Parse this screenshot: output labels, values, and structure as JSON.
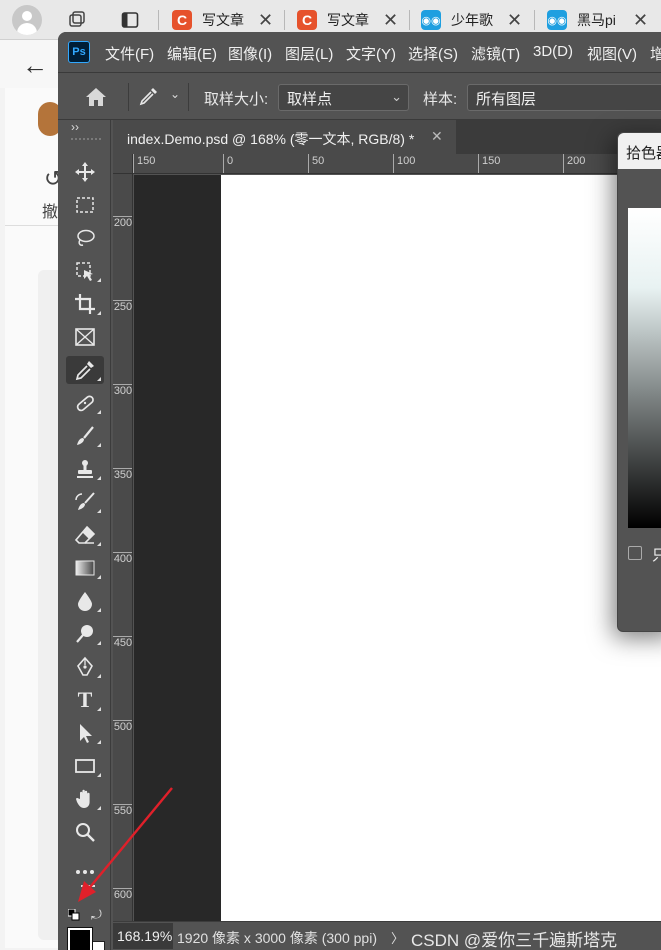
{
  "browser": {
    "tabs": [
      {
        "icon": "csdn-icon",
        "title": "写文章",
        "color": "#e6522c"
      },
      {
        "icon": "csdn-icon",
        "title": "写文章",
        "color": "#e6522c"
      },
      {
        "icon": "bilibili-icon",
        "title": "少年歌",
        "color": "#1e9fe0"
      },
      {
        "icon": "bilibili-icon",
        "title": "黑马pi",
        "color": "#1e9fe0"
      }
    ],
    "bg_undo_label": "撤"
  },
  "ps": {
    "logo": "Ps",
    "menu": [
      "文件(F)",
      "编辑(E)",
      "图像(I)",
      "图层(L)",
      "文字(Y)",
      "选择(S)",
      "滤镜(T)",
      "3D(D)",
      "视图(V)",
      "增"
    ],
    "options": {
      "sample_size_label": "取样大小:",
      "sample_size_value": "取样点",
      "sample_label": "样本:",
      "sample_value": "所有图层"
    },
    "document_tab": "index.Demo.psd @ 168% (零一文本, RGB/8) *",
    "ruler_h": [
      "150",
      "0",
      "50",
      "100",
      "150",
      "200"
    ],
    "ruler_v": [
      "200",
      "250",
      "300",
      "350",
      "400",
      "450",
      "500",
      "550",
      "600"
    ],
    "status": {
      "zoom": "168.19%",
      "doc_info": "1920 像素 x 3000 像素 (300 ppi)",
      "arrow": "〉"
    },
    "color_picker": {
      "title": "拾色器",
      "checkbox_label": "只"
    },
    "foreground_color": "#000000",
    "background_color": "#ffffff"
  },
  "watermark": "CSDN @爱你三千遍斯塔克",
  "colors": {
    "annotation_arrow": "#e0202a",
    "ps_accent": "#31a8ff"
  }
}
